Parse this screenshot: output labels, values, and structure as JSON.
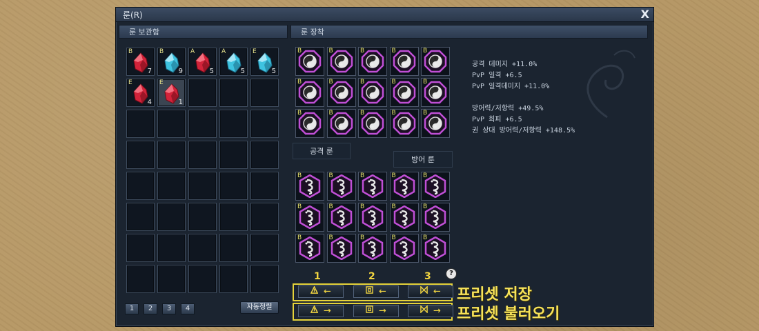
{
  "window": {
    "title": "룬(R)",
    "close_label": "X"
  },
  "storage": {
    "header": "룬 보관함",
    "items": [
      {
        "grade": "B",
        "count": "7",
        "color": "red"
      },
      {
        "grade": "B",
        "count": "9",
        "color": "blue"
      },
      {
        "grade": "A",
        "count": "5",
        "color": "red"
      },
      {
        "grade": "A",
        "count": "5",
        "color": "blue"
      },
      {
        "grade": "E",
        "count": "5",
        "color": "blue"
      },
      {
        "grade": "E",
        "count": "4",
        "color": "red"
      },
      {
        "grade": "E",
        "count": "1",
        "color": "red"
      }
    ],
    "pages": [
      "1",
      "2",
      "3",
      "4"
    ],
    "sort_label": "자동정렬"
  },
  "equip": {
    "header": "룬 장착",
    "attack_tab": "공격 룬",
    "defense_tab": "방어 룬",
    "attack_grade": "B",
    "defense_grade": "B"
  },
  "stats": [
    "공격 데미지 +11.0%",
    "PvP 일격 +6.5",
    "PvP 일격데미지 +11.0%",
    "",
    "방어력/저항력 +49.5%",
    "PvP 회피 +6.5",
    "권 상대 방어력/저항력 +148.5%"
  ],
  "presets": {
    "numbers": [
      "1",
      "2",
      "3"
    ],
    "save_label": "프리셋 저장",
    "load_label": "프리셋 불러오기",
    "save_arrow": "←",
    "load_arrow": "→",
    "icons": [
      "triangle-icon",
      "spiral-icon",
      "hourglass-icon"
    ],
    "help": "?"
  },
  "colors": {
    "accent": "#f3d640",
    "rune_border": "#b04cc4"
  }
}
